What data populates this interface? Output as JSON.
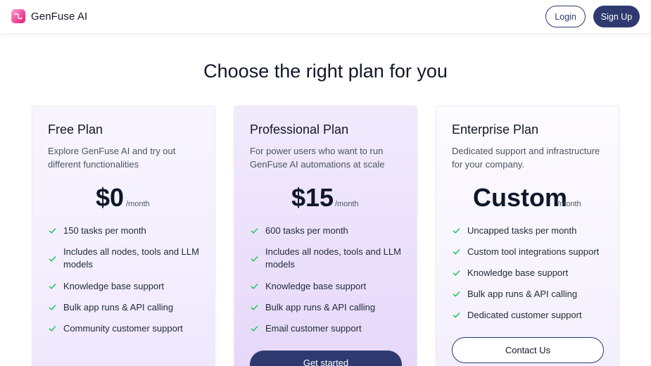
{
  "header": {
    "brand": "GenFuse AI",
    "login_label": "Login",
    "signup_label": "Sign Up"
  },
  "heading": "Choose the right plan for you",
  "colors": {
    "primary": "#2e3a6f",
    "check": "#22c55e",
    "logo": "#ec4899"
  },
  "plans": [
    {
      "title": "Free Plan",
      "description": "Explore GenFuse AI and try out different functionalities",
      "price": "$0",
      "period": "/month",
      "features": [
        "150 tasks per month",
        "Includes all nodes, tools and LLM models",
        "Knowledge base support",
        "Bulk app runs & API calling",
        "Community customer support"
      ]
    },
    {
      "title": "Professional Plan",
      "description": "For power users who want to run GenFuse AI automations at scale",
      "price": "$15",
      "period": "/month",
      "features": [
        "600 tasks per month",
        "Includes all nodes, tools and LLM models",
        "Knowledge base support",
        "Bulk app runs & API calling",
        "Email customer support"
      ],
      "cta": "Get started"
    },
    {
      "title": "Enterprise Plan",
      "description": "Dedicated support and infrastructure for your company.",
      "price": "Custom",
      "period": "/month",
      "features": [
        "Uncapped tasks per month",
        "Custom tool integrations support",
        "Knowledge base support",
        "Bulk app runs & API calling",
        "Dedicated customer support"
      ],
      "cta": "Contact Us"
    }
  ]
}
